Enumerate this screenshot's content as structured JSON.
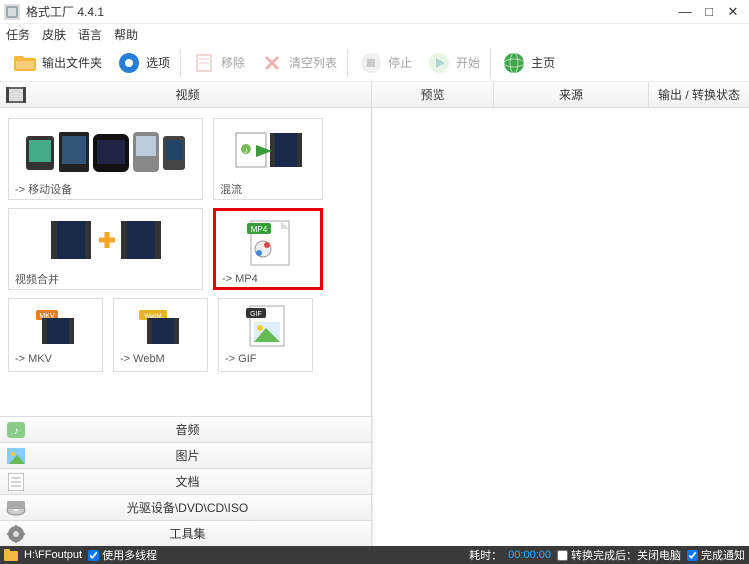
{
  "window": {
    "title": "格式工厂 4.4.1"
  },
  "menubar": {
    "tasks": "任务",
    "skin": "皮肤",
    "language": "语言",
    "help": "帮助"
  },
  "toolbar": {
    "output": "输出文件夹",
    "options": "选项",
    "remove": "移除",
    "clear": "清空列表",
    "stop": "停止",
    "start": "开始",
    "home": "主页"
  },
  "sections": {
    "video": "视频",
    "audio": "音频",
    "image": "图片",
    "document": "文档",
    "disc": "光驱设备\\DVD\\CD\\ISO",
    "tools": "工具集"
  },
  "cards": {
    "mobile": "-> 移动设备",
    "mux": "混流",
    "merge": "视频合并",
    "mp4": "-> MP4",
    "mkv": "-> MKV",
    "webm": "-> WebM",
    "gif": "-> GIF",
    "mp4_badge": "MP4",
    "mkv_badge": "MKV",
    "webm_badge": "WebM",
    "gif_badge": "GIF"
  },
  "right": {
    "preview": "预览",
    "source": "来源",
    "status": "输出 / 转换状态"
  },
  "statusbar": {
    "output_path": "H:\\FFoutput",
    "multithread": "使用多线程",
    "elapsed_label": "耗时：",
    "elapsed_time": "00:00:00",
    "shutdown": "转换完成后：关闭电脑",
    "notify": "完成通知"
  }
}
